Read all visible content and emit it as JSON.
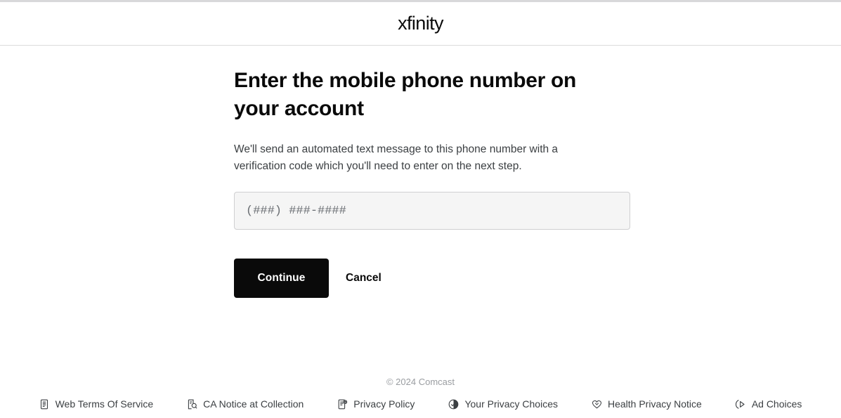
{
  "header": {
    "brand": "xfinity",
    "brand_icon": "xfinity-logo"
  },
  "main": {
    "title": "Enter the mobile phone number on your account",
    "description": "We'll send an automated text message to this phone number with a verification code which you'll need to enter on the next step.",
    "phone_field": {
      "value": "",
      "placeholder": "(###) ###-####"
    },
    "continue_label": "Continue",
    "cancel_label": "Cancel"
  },
  "footer": {
    "copyright": "© 2024 Comcast",
    "links": [
      {
        "label": "Web Terms Of Service",
        "icon": "document-icon"
      },
      {
        "label": "CA Notice at Collection",
        "icon": "document-search-icon"
      },
      {
        "label": "Privacy Policy",
        "icon": "document-gear-icon"
      },
      {
        "label": "Your Privacy Choices",
        "icon": "privacy-choices-icon"
      },
      {
        "label": "Health Privacy Notice",
        "icon": "heart-shield-icon"
      },
      {
        "label": "Ad Choices",
        "icon": "ad-choices-icon"
      }
    ]
  },
  "colors": {
    "accent": "#0a0a0a",
    "page_bg": "#ffffff",
    "field_bg": "#f5f5f5",
    "border": "#dcdcdc"
  }
}
